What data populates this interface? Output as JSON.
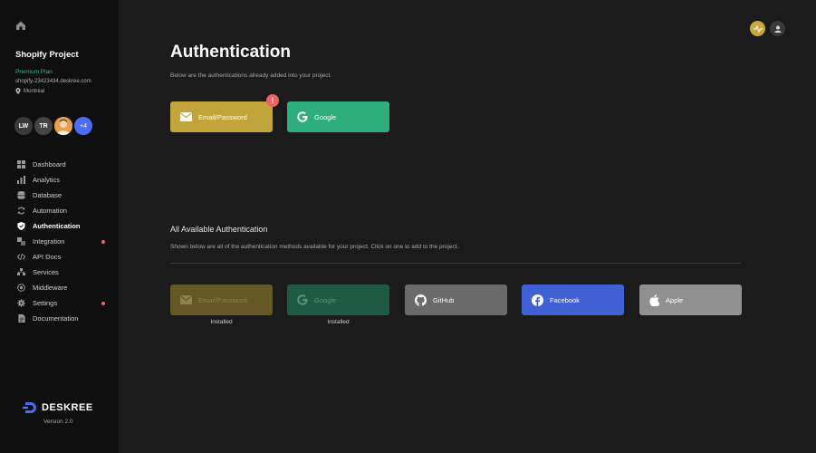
{
  "sidebar": {
    "project_title": "Shopify Project",
    "plan": "Premium Plan",
    "domain": "shopify-23423434.deskree.com",
    "location": "Montréal",
    "avatars": [
      {
        "initials": "LW"
      },
      {
        "initials": "TR"
      },
      {
        "initials": ""
      },
      {
        "initials": "+4"
      }
    ],
    "nav": [
      {
        "label": "Dashboard",
        "icon": "grid-icon"
      },
      {
        "label": "Analytics",
        "icon": "bar-chart-icon"
      },
      {
        "label": "Database",
        "icon": "database-icon"
      },
      {
        "label": "Automation",
        "icon": "refresh-icon"
      },
      {
        "label": "Authentication",
        "icon": "shield-icon",
        "active": true
      },
      {
        "label": "Integration",
        "icon": "puzzle-icon",
        "dot": true
      },
      {
        "label": "API Docs",
        "icon": "code-icon"
      },
      {
        "label": "Services",
        "icon": "services-icon"
      },
      {
        "label": "Middleware",
        "icon": "target-icon"
      },
      {
        "label": "Settings",
        "icon": "gear-icon",
        "dot": true
      },
      {
        "label": "Documentation",
        "icon": "document-icon"
      }
    ],
    "brand": "DESKREE",
    "version": "Version 2.0"
  },
  "main": {
    "title": "Authentication",
    "subtitle": "Below are the authentications already added into your project.",
    "added": [
      {
        "label": "Email/Password",
        "icon": "mail-icon",
        "badge": "!"
      },
      {
        "label": "Google",
        "icon": "google-icon"
      }
    ],
    "available_title": "All Available Authentication",
    "available_subtitle": "Shown below are all of the authentication methods available for your project. Click on one to add to the project.",
    "available": [
      {
        "label": "Email/Password",
        "icon": "mail-icon",
        "status": "Installed"
      },
      {
        "label": "Google",
        "icon": "google-icon",
        "status": "Installed"
      },
      {
        "label": "GitHub",
        "icon": "github-icon"
      },
      {
        "label": "Facebook",
        "icon": "facebook-icon"
      },
      {
        "label": "Apple",
        "icon": "apple-icon"
      }
    ]
  },
  "colors": {
    "accent_gold": "#c2a53a",
    "accent_green": "#2fae7d",
    "facebook_blue": "#4160d4",
    "alert_red": "#f06262"
  }
}
